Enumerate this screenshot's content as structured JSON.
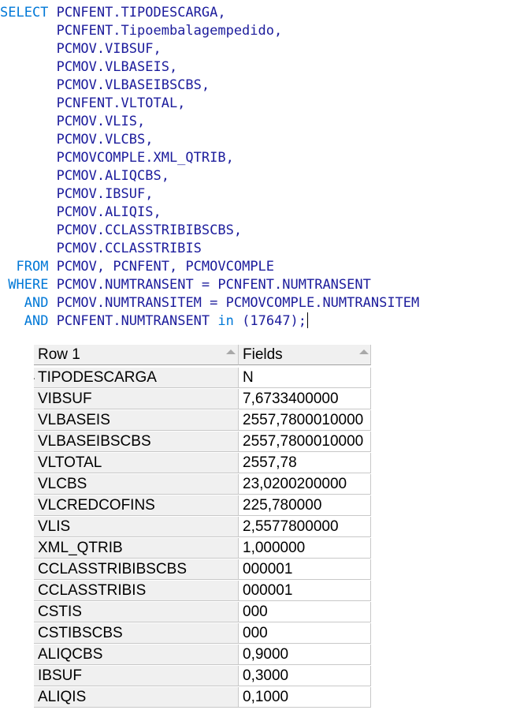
{
  "sql": {
    "line1": {
      "kw": "SELECT",
      "text": "PCNFENT.TIPODESCARGA,"
    },
    "fields": [
      "PCNFENT.Tipoembalagempedido,",
      "PCMOV.VIBSUF,",
      "PCMOV.VLBASEIS,",
      "PCMOV.VLBASEIBSCBS,",
      "PCNFENT.VLTOTAL,",
      "PCMOV.VLIS,",
      "PCMOV.VLCBS,",
      "PCMOVCOMPLE.XML_QTRIB,",
      "PCMOV.ALIQCBS,",
      "PCMOV.IBSUF,",
      "PCMOV.ALIQIS,",
      "PCMOV.CCLASSTRIBIBSCBS,",
      "PCMOV.CCLASSTRIBIS"
    ],
    "from": {
      "kw": "FROM",
      "text": "PCMOV, PCNFENT, PCMOVCOMPLE"
    },
    "where": {
      "kw": "WHERE",
      "text": "PCMOV.NUMTRANSENT = PCNFENT.NUMTRANSENT"
    },
    "and1": {
      "kw": "AND",
      "text": "PCMOV.NUMTRANSITEM = PCMOVCOMPLE.NUMTRANSITEM"
    },
    "and2": {
      "kw": "AND",
      "text_before": "PCNFENT.NUMTRANSENT",
      "in_kw": "in",
      "text_after": "(17647);"
    }
  },
  "grid": {
    "header": {
      "col1": "Row 1",
      "col2": "Fields"
    },
    "rows": [
      {
        "name": "TIPODESCARGA",
        "value": "N"
      },
      {
        "name": "VIBSUF",
        "value": "7,6733400000"
      },
      {
        "name": "VLBASEIS",
        "value": "2557,7800010000"
      },
      {
        "name": "VLBASEIBSCBS",
        "value": "2557,7800010000"
      },
      {
        "name": "VLTOTAL",
        "value": "2557,78"
      },
      {
        "name": "VLCBS",
        "value": "23,0200200000"
      },
      {
        "name": "VLCREDCOFINS",
        "value": "225,780000"
      },
      {
        "name": "VLIS",
        "value": "2,5577800000"
      },
      {
        "name": "XML_QTRIB",
        "value": "1,000000"
      },
      {
        "name": "CCLASSTRIBIBSCBS",
        "value": "000001"
      },
      {
        "name": "CCLASSTRIBIS",
        "value": "000001"
      },
      {
        "name": "CSTIS",
        "value": "000"
      },
      {
        "name": "CSTIBSCBS",
        "value": "000"
      },
      {
        "name": "ALIQCBS",
        "value": "0,9000"
      },
      {
        "name": "IBSUF",
        "value": "0,3000"
      },
      {
        "name": "ALIQIS",
        "value": "0,1000"
      }
    ]
  },
  "colors": {
    "keyword": "#0078d7",
    "identifier": "#1c1c9c"
  }
}
